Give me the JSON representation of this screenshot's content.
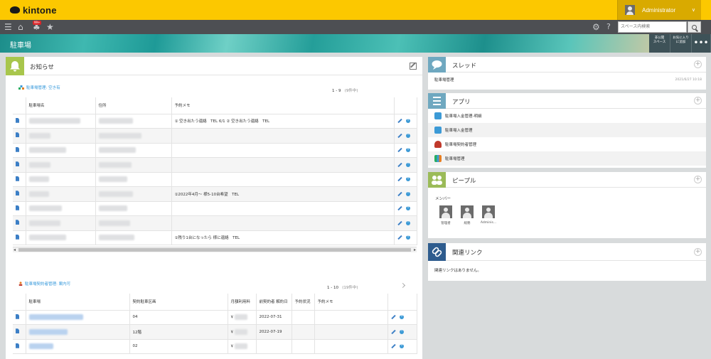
{
  "header": {
    "logo_text": "kintone",
    "user_name": "Administrator",
    "notification_badge": "99+",
    "search_placeholder": "スペース内検索"
  },
  "space": {
    "title": "駐車場",
    "buttons": [
      {
        "label": "非公開\nスペース"
      },
      {
        "label": "お気に入り\nに追加"
      },
      {
        "label": "•••"
      }
    ]
  },
  "notice": {
    "title": "お知らせ",
    "list1": {
      "app_link": "駐車場管理: 空き有",
      "pager": "1 - 9",
      "pager_total": "(9件中)",
      "columns": [
        "駐車場名",
        "住所",
        "予約メモ"
      ],
      "memos": [
        "①                          空き出たう還絡　TEL                      6/1 ②                空き出たう還絡　TEL",
        "",
        "",
        "",
        "",
        "①2022年4月～       様5-10台希望　TEL",
        "",
        "",
        "①残り1台になったら                様に還絡　TEL"
      ]
    },
    "list2": {
      "app_link": "駐車場契約者管理: 案内可",
      "pager": "1 - 10",
      "pager_total": "(19件中)",
      "columns": [
        "駐車場",
        "契約駐車区画",
        "月額利用料",
        "前契約者 解約日",
        "予約状況",
        "予約メモ"
      ],
      "rows": [
        {
          "section": "04",
          "fee": "¥",
          "date": "2022-07-31"
        },
        {
          "section": "12階",
          "fee": "¥",
          "date": "2022-07-19"
        },
        {
          "section": "02",
          "fee": "¥",
          "date": ""
        }
      ]
    }
  },
  "thread": {
    "title": "スレッド",
    "item": "駐車場管理",
    "timestamp": "2021/6/27 10:18"
  },
  "apps": {
    "title": "アプリ",
    "items": [
      {
        "label": "駐車場入金管理-明細",
        "color": "#3c9ad6"
      },
      {
        "label": "駐車場入金管理",
        "color": "#3c9ad6"
      },
      {
        "label": "駐車場契約者管理",
        "color": "#c0392b"
      },
      {
        "label": "駐車場管理",
        "color": "#27ae60"
      }
    ]
  },
  "people": {
    "title": "ピープル",
    "members_label": "メンバー",
    "members": [
      "管理者",
      "総務",
      "Adminis..."
    ]
  },
  "links": {
    "title": "関連リンク",
    "empty_text": "関連リンクはありません。"
  }
}
